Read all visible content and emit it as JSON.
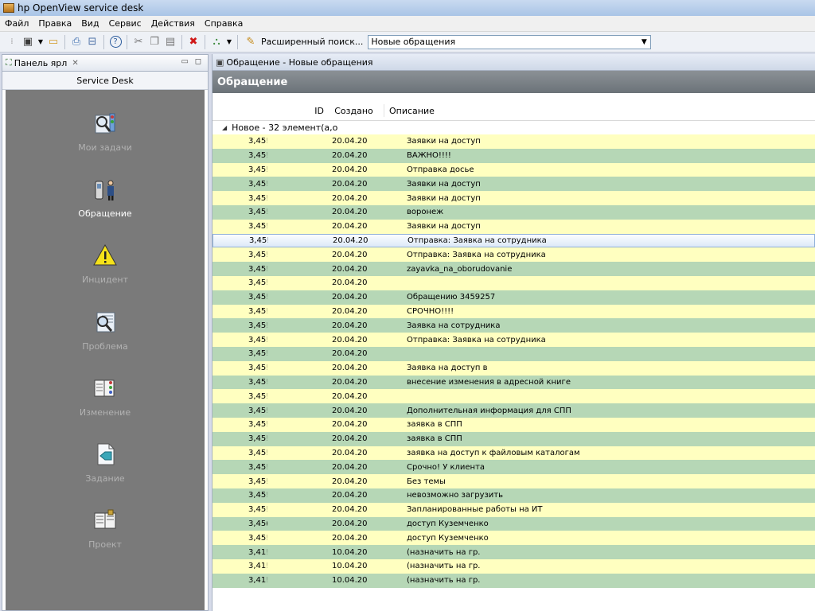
{
  "window": {
    "title": "hp OpenView service desk"
  },
  "menu": [
    "Файл",
    "Правка",
    "Вид",
    "Сервис",
    "Действия",
    "Справка"
  ],
  "toolbar": {
    "advanced_search_label": "Расширенный поиск...",
    "view_combo_value": "Новые обращения"
  },
  "left_panel": {
    "tab_label": "Панель ярл",
    "header": "Service Desk",
    "items": [
      {
        "label": "Мои задачи",
        "icon": "tasks-icon",
        "active": false
      },
      {
        "label": "Обращение",
        "icon": "service-call-icon",
        "active": true
      },
      {
        "label": "Инцидент",
        "icon": "warning-icon",
        "active": false
      },
      {
        "label": "Проблема",
        "icon": "problem-icon",
        "active": false
      },
      {
        "label": "Изменение",
        "icon": "change-icon",
        "active": false
      },
      {
        "label": "Задание",
        "icon": "work-order-icon",
        "active": false
      },
      {
        "label": "Проект",
        "icon": "project-icon",
        "active": false
      }
    ]
  },
  "right_panel": {
    "tab_label": "Обращение - Новые обращения",
    "header": "Обращение",
    "columns": {
      "id": "ID",
      "created": "Создано",
      "description": "Описание"
    },
    "group_label": "Новое - 32 элемент(а,о",
    "rows": [
      {
        "id": "3,45!",
        "created": "20.04.20",
        "description": "Заявки на доступ"
      },
      {
        "id": "3,45!",
        "created": "20.04.20",
        "description": "ВАЖНО!!!!"
      },
      {
        "id": "3,45!",
        "created": "20.04.20",
        "description": "Отправка досье"
      },
      {
        "id": "3,45!",
        "created": "20.04.20",
        "description": "Заявки на доступ"
      },
      {
        "id": "3,45!",
        "created": "20.04.20",
        "description": "Заявки на доступ"
      },
      {
        "id": "3,45!",
        "created": "20.04.20",
        "description": "воронеж"
      },
      {
        "id": "3,45!",
        "created": "20.04.20",
        "description": "Заявки на доступ"
      },
      {
        "id": "3,45!",
        "created": "20.04.20",
        "description": "Отправка: Заявка на сотрудника",
        "selected": true
      },
      {
        "id": "3,45!",
        "created": "20.04.20",
        "description": "Отправка: Заявка на сотрудника"
      },
      {
        "id": "3,45!",
        "created": "20.04.20",
        "description": "zayavka_na_oborudovanie"
      },
      {
        "id": "3,45!",
        "created": "20.04.20",
        "description": ""
      },
      {
        "id": "3,45!",
        "created": "20.04.20",
        "description": "Обращению 3459257"
      },
      {
        "id": "3,45!",
        "created": "20.04.20",
        "description": "СРОЧНО!!!!"
      },
      {
        "id": "3,45!",
        "created": "20.04.20",
        "description": "Заявка на сотрудника"
      },
      {
        "id": "3,45!",
        "created": "20.04.20",
        "description": "Отправка: Заявка на сотрудника"
      },
      {
        "id": "3,45!",
        "created": "20.04.20",
        "description": ""
      },
      {
        "id": "3,45!",
        "created": "20.04.20",
        "description": "Заявка на доступ в"
      },
      {
        "id": "3,45!",
        "created": "20.04.20",
        "description": "внесение изменения в адресной книге"
      },
      {
        "id": "3,45!",
        "created": "20.04.20",
        "description": ""
      },
      {
        "id": "3,45!",
        "created": "20.04.20",
        "description": "Дополнительная информация для СПП"
      },
      {
        "id": "3,45!",
        "created": "20.04.20",
        "description": "заявка в СПП"
      },
      {
        "id": "3,45!",
        "created": "20.04.20",
        "description": "заявка в СПП"
      },
      {
        "id": "3,45!",
        "created": "20.04.20",
        "description": "заявка на доступ к файловым каталогам"
      },
      {
        "id": "3,45!",
        "created": "20.04.20",
        "description": "Срочно! У клиента"
      },
      {
        "id": "3,45!",
        "created": "20.04.20",
        "description": "Без темы"
      },
      {
        "id": "3,45!",
        "created": "20.04.20",
        "description": "невозможно загрузить"
      },
      {
        "id": "3,45!",
        "created": "20.04.20",
        "description": "Запланированные работы на ИТ"
      },
      {
        "id": "3,45(",
        "created": "20.04.20",
        "description": "доступ Куземченко"
      },
      {
        "id": "3,45!",
        "created": "20.04.20",
        "description": "доступ Куземченко"
      },
      {
        "id": "3,41!",
        "created": "10.04.20",
        "description": "(назначить на гр."
      },
      {
        "id": "3,41!",
        "created": "10.04.20",
        "description": "(назначить на гр."
      },
      {
        "id": "3,41!",
        "created": "10.04.20",
        "description": "(назначить на гр."
      }
    ]
  },
  "colors": {
    "row_odd": "#ffffc0",
    "row_even": "#b6d7b6",
    "nav_bg": "#7a7a7a",
    "header_bg": "#7b8187"
  }
}
